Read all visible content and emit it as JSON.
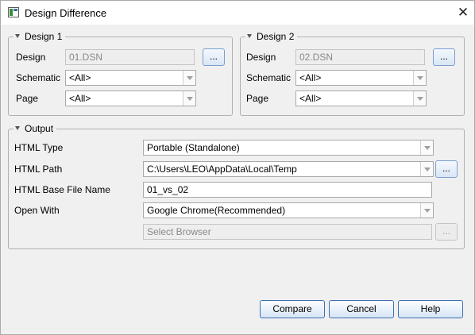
{
  "window": {
    "title": "Design Difference",
    "close_glyph": "✕"
  },
  "design1": {
    "legend": "Design 1",
    "design_label": "Design",
    "design_value": "01.DSN",
    "browse_label": "...",
    "schematic_label": "Schematic",
    "schematic_value": "<All>",
    "page_label": "Page",
    "page_value": "<All>"
  },
  "design2": {
    "legend": "Design 2",
    "design_label": "Design",
    "design_value": "02.DSN",
    "browse_label": "...",
    "schematic_label": "Schematic",
    "schematic_value": "<All>",
    "page_label": "Page",
    "page_value": "<All>"
  },
  "output": {
    "legend": "Output",
    "html_type_label": "HTML Type",
    "html_type_value": "Portable (Standalone)",
    "html_path_label": "HTML Path",
    "html_path_value": "C:\\Users\\LEO\\AppData\\Local\\Temp",
    "html_path_browse": "...",
    "base_name_label": "HTML Base File Name",
    "base_name_value": "01_vs_02",
    "open_with_label": "Open With",
    "open_with_value": "Google Chrome(Recommended)",
    "select_browser_placeholder": "Select Browser",
    "select_browser_browse": "..."
  },
  "buttons": {
    "compare": "Compare",
    "cancel": "Cancel",
    "help": "Help"
  }
}
